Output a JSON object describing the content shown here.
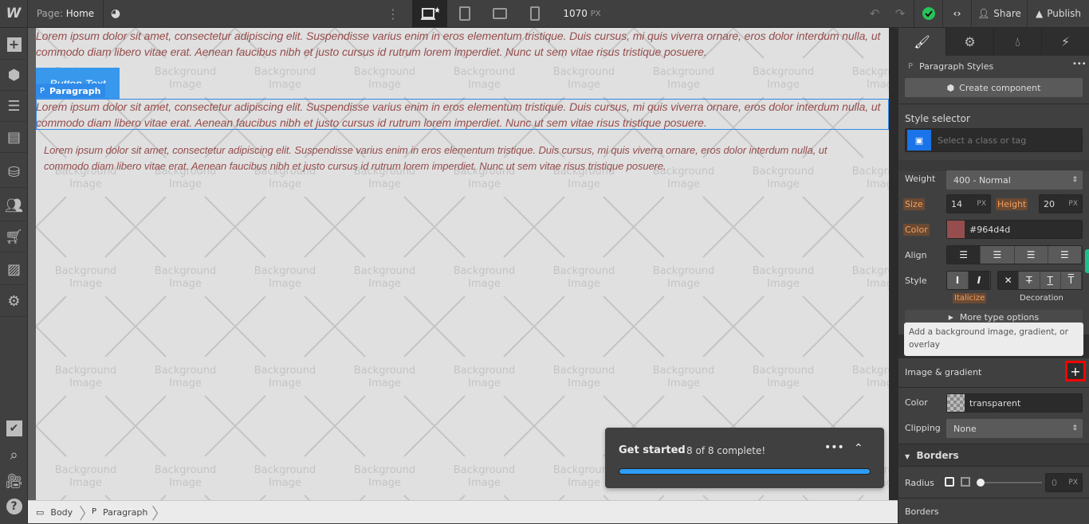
{
  "topbar": {
    "logo": "W",
    "page_label": "Page:",
    "page_name": "Home",
    "width_value": "1070",
    "width_unit": "PX",
    "share": "Share",
    "publish": "Publish",
    "icons": [
      "webflow-logo",
      "eye-icon",
      "more-vertical-icon",
      "desktop-icon",
      "tablet-icon",
      "tablet-landscape-icon",
      "mobile-icon",
      "undo-icon",
      "redo-icon",
      "status-check-icon",
      "code-icon",
      "user-icon",
      "rocket-icon"
    ]
  },
  "leftbar": {
    "icons": [
      "add-icon",
      "components-icon",
      "navigator-icon",
      "pages-icon",
      "cms-icon",
      "users-icon",
      "ecommerce-icon",
      "assets-icon",
      "settings-icon",
      "audit-check-icon",
      "search-icon",
      "video-icon",
      "help-icon"
    ]
  },
  "canvas": {
    "placeholder_line1": "Background",
    "placeholder_line2": "Image",
    "paragraph_text": "Lorem ipsum dolor sit amet, consectetur adipiscing elit. Suspendisse varius enim in eros elementum tristique. Duis cursus, mi quis viverra ornare, eros dolor interdum nulla, ut commodo diam libero vitae erat. Aenean faucibus nibh et justo cursus id rutrum lorem imperdiet. Nunc ut sem vitae risus tristique posuere.",
    "button_text": "Button Text",
    "selected_badge_icon": "P",
    "selected_badge_label": "Paragraph",
    "text_color": "#964d4d",
    "selection_color": "#2f8ae9"
  },
  "get_started": {
    "title": "Get started",
    "status": "8 of 8 complete!",
    "progress": 1.0
  },
  "breadcrumb": [
    {
      "icon": "body-icon",
      "label": "Body"
    },
    {
      "icon": "P",
      "label": "Paragraph"
    }
  ],
  "panel": {
    "tabs": [
      "style-brush-icon",
      "settings-gear-icon",
      "interactions-drops-icon",
      "lightning-icon"
    ],
    "element_icon": "P",
    "element_title": "Paragraph Styles",
    "more": "•••",
    "create_component": "Create component",
    "style_selector_label": "Style selector",
    "style_selector_placeholder": "Select a class or tag",
    "weight_label": "Weight",
    "weight_value": "400 - Normal",
    "size_label": "Size",
    "size_value": "14",
    "size_unit": "PX",
    "height_label": "Height",
    "height_value": "20",
    "height_unit": "PX",
    "color_label": "Color",
    "color_value": "#964d4d",
    "align_label": "Align",
    "align_selected": "left",
    "style_label": "Style",
    "italicize_label": "Italicize",
    "decoration_label": "Decoration",
    "style_buttons": [
      "I",
      "I"
    ],
    "decoration_buttons": [
      "✕",
      "T",
      "T",
      "T"
    ],
    "more_type_options": "More type options",
    "tooltip": "Add a background image, gradient, or overlay",
    "image_gradient_label": "Image & gradient",
    "add_button": "+",
    "bg_color_label": "Color",
    "bg_color_value": "transparent",
    "clipping_label": "Clipping",
    "clipping_value": "None",
    "borders_section": "Borders",
    "radius_label": "Radius",
    "radius_value": "0",
    "radius_unit": "PX",
    "borders_label": "Borders"
  }
}
